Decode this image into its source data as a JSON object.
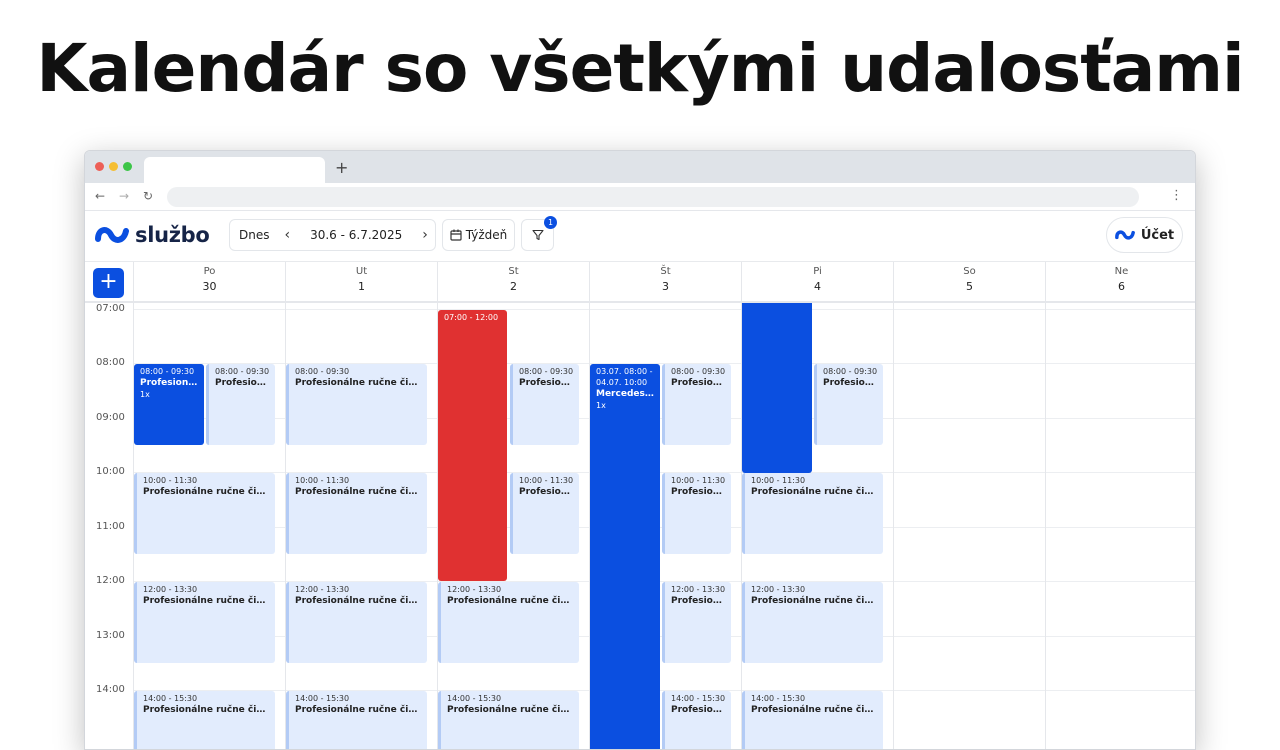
{
  "headline": "Kalendár so všetkými udalosťami",
  "browser": {
    "new_tab": "+",
    "back": "←",
    "forward": "→",
    "reload": "↻",
    "menu": "⋮"
  },
  "app": {
    "brand": "službo",
    "toolbar": {
      "today": "Dnes",
      "prev": "‹",
      "next": "›",
      "range": "30.6 - 6.7.2025",
      "view": "Týždeň",
      "filter_badge": "1"
    },
    "account": "Účet",
    "add": "+"
  },
  "days": [
    {
      "name": "Po",
      "date": "30"
    },
    {
      "name": "Ut",
      "date": "1"
    },
    {
      "name": "St",
      "date": "2"
    },
    {
      "name": "Št",
      "date": "3"
    },
    {
      "name": "Pi",
      "date": "4"
    },
    {
      "name": "So",
      "date": "5"
    },
    {
      "name": "Ne",
      "date": "6"
    }
  ],
  "hours": [
    "07:00",
    "08:00",
    "09:00",
    "10:00",
    "11:00",
    "12:00",
    "13:00",
    "14:00"
  ],
  "events": [
    {
      "style": "blue",
      "time": "08:00 - 09:30",
      "name": "Profesionál...",
      "count": "1x"
    },
    {
      "style": "light",
      "time": "08:00 - 09:30",
      "name": "Profesionál..."
    },
    {
      "style": "light",
      "time": "10:00 - 11:30",
      "name": "Profesionálne ručne čistení..."
    },
    {
      "style": "light",
      "time": "12:00 - 13:30",
      "name": "Profesionálne ručne čistení..."
    },
    {
      "style": "light",
      "time": "14:00 - 15:30",
      "name": "Profesionálne ručne čistení..."
    },
    {
      "style": "light",
      "time": "08:00 - 09:30",
      "name": "Profesionálne ručne čistení..."
    },
    {
      "style": "light",
      "time": "10:00 - 11:30",
      "name": "Profesionálne ručne čistení..."
    },
    {
      "style": "light",
      "time": "12:00 - 13:30",
      "name": "Profesionálne ručne čistení..."
    },
    {
      "style": "light",
      "time": "14:00 - 15:30",
      "name": "Profesionálne ručne čistení..."
    },
    {
      "style": "red",
      "time": "07:00 - 12:00",
      "name": ""
    },
    {
      "style": "light",
      "time": "08:00 - 09:30",
      "name": "Profesionál..."
    },
    {
      "style": "light",
      "time": "10:00 - 11:30",
      "name": "Profesionál..."
    },
    {
      "style": "light",
      "time": "12:00 - 13:30",
      "name": "Profesionálne ručne čistení..."
    },
    {
      "style": "light",
      "time": "14:00 - 15:30",
      "name": "Profesionálne ručne čistení..."
    },
    {
      "style": "blue",
      "time": "03.07. 08:00 - 04.07. 10:00",
      "name": "Mercedes S...",
      "count": "1x"
    },
    {
      "style": "light",
      "time": "08:00 - 09:30",
      "name": "Profesionál..."
    },
    {
      "style": "light",
      "time": "10:00 - 11:30",
      "name": "Profesionál..."
    },
    {
      "style": "light",
      "time": "12:00 - 13:30",
      "name": "Profesionál..."
    },
    {
      "style": "light",
      "time": "14:00 - 15:30",
      "name": "Profesionál..."
    },
    {
      "style": "blue",
      "time": "",
      "name": ""
    },
    {
      "style": "light",
      "time": "08:00 - 09:30",
      "name": "Profesionál..."
    },
    {
      "style": "light",
      "time": "10:00 - 11:30",
      "name": "Profesionálne ručne čistení..."
    },
    {
      "style": "light",
      "time": "12:00 - 13:30",
      "name": "Profesionálne ručne čistení..."
    },
    {
      "style": "light",
      "time": "14:00 - 15:30",
      "name": "Profesionálne ručne čistení..."
    }
  ],
  "colors": {
    "primary": "#0b4fe0",
    "danger": "#e03131",
    "event_light": "#e2ecfd",
    "brand_text": "#162447"
  }
}
